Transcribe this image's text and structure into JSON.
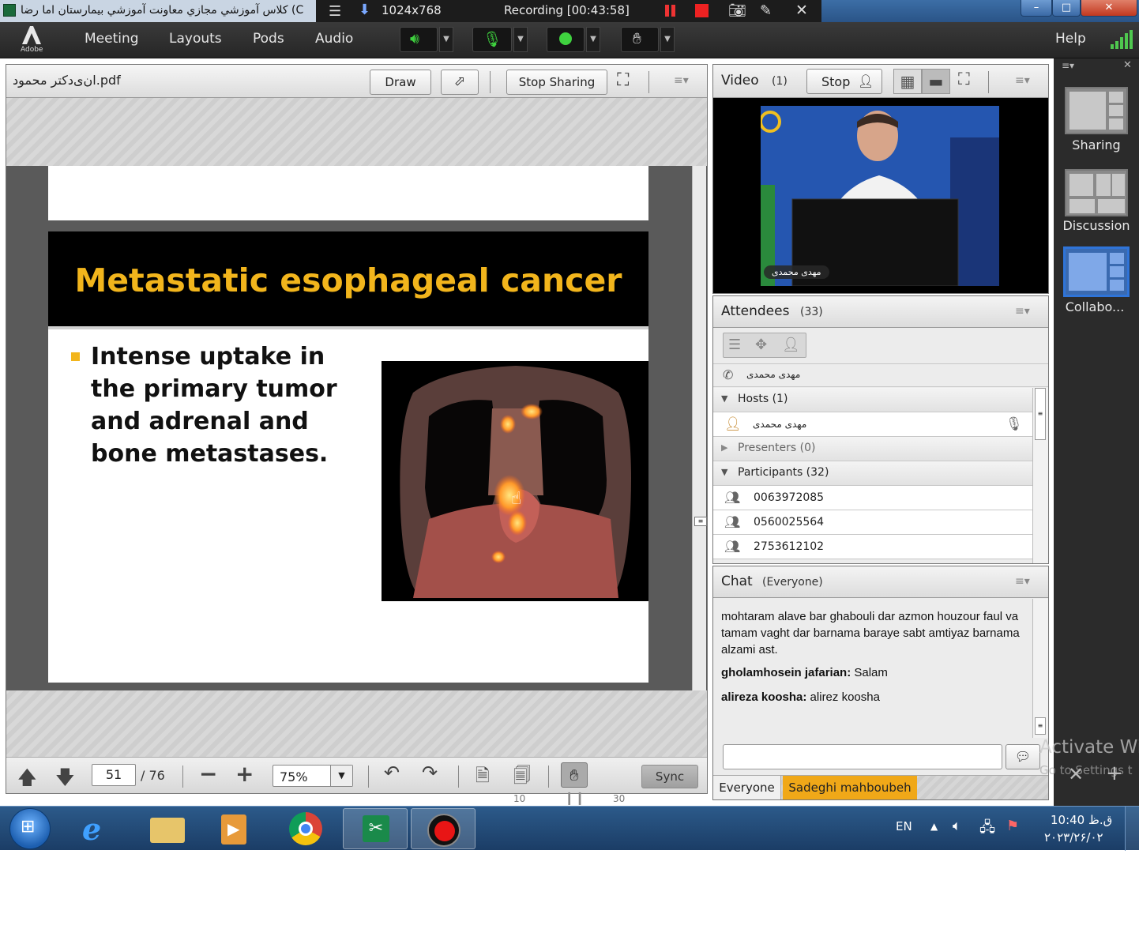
{
  "window": {
    "title": "كلاس آموزشي مجازي معاونت آموزشي بيمارستان اما رضا (C",
    "resolution": "1024x768",
    "recording": "Recording [00:43:58]",
    "controls": {
      "minimize": "–",
      "maximize": "□",
      "close": "✕"
    }
  },
  "menu": {
    "logo": "Adobe",
    "items": [
      "Meeting",
      "Layouts",
      "Pods",
      "Audio"
    ],
    "help": "Help"
  },
  "share_pod": {
    "file_name": "ان‌ی‌دکتر محمود.pdf",
    "draw_label": "Draw",
    "stop_sharing_label": "Stop Sharing",
    "slide": {
      "title": "Metastatic esophageal cancer",
      "bullet": "Intense uptake in the primary tumor and adrenal and bone metastases."
    },
    "footer": {
      "page": "51",
      "total": "/ 76",
      "zoom": "75%",
      "sync_label": "Sync"
    }
  },
  "video_pod": {
    "title": "Video",
    "count": "(1)",
    "stop_label": "Stop",
    "presenter_name": "مهدی محمدی"
  },
  "attendees_pod": {
    "title": "Attendees",
    "count": "(33)",
    "phone_user": "مهدی محمدی",
    "hosts_label": "Hosts (1)",
    "host_name": "مهدی محمدی",
    "presenters_label": "Presenters (0)",
    "participants_label": "Participants (32)",
    "participants": [
      "0063972085",
      "0560025564",
      "2753612102"
    ]
  },
  "chat_pod": {
    "title": "Chat",
    "scope": "(Everyone)",
    "messages": [
      {
        "sender": "",
        "text": "mohtaram alave bar ghabouli dar azmon houzour faul va tamam vaght dar barnama baraye sabt amtiyaz barnama alzami ast."
      },
      {
        "sender": "gholamhosein jafarian:",
        "text": " Salam"
      },
      {
        "sender": "alireza koosha:",
        "text": " alirez koosha"
      }
    ],
    "input_placeholder": "",
    "tabs": [
      "Everyone",
      "Sadeghi  mahboubeh"
    ]
  },
  "layouts": [
    {
      "label": "Sharing"
    },
    {
      "label": "Discussion"
    },
    {
      "label": "Collabo..."
    }
  ],
  "overlay": {
    "seek_back": "10",
    "seek_forward": "30"
  },
  "watermark": {
    "line1": "Activate Wi",
    "line2": "Go to Settings t"
  },
  "taskbar": {
    "language": "EN",
    "time": "10:40 ق.ظ",
    "date": "۲۰۲۳/۲۶/۰۲"
  },
  "colors": {
    "slide_title": "#f2b51c",
    "bullet": "#f2b51c",
    "active_chat_tab": "#f0a818",
    "taskbar": "#1b3d66"
  }
}
